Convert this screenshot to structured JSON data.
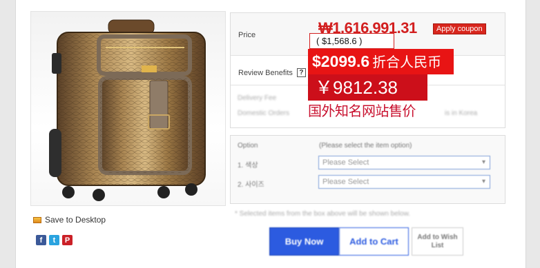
{
  "product": {
    "image_alt": "Brown snakeskin-texture rolling suitcase",
    "save_label": "Save to Desktop"
  },
  "social": {
    "facebook": "f",
    "twitter": "t",
    "pinterest": "P"
  },
  "price": {
    "label": "Price",
    "krw": "₩1,616,991.31",
    "coupon_label": "Apply coupon",
    "usd": "( $1,568.6 )"
  },
  "review": {
    "label": "Review Benefits",
    "help": "?"
  },
  "overlay": {
    "usd_price": "$2099.6",
    "usd_note": "折合人民币",
    "cny_price": "￥9812.38",
    "note": "国外知名网站售价"
  },
  "shipping": {
    "delivery_label": "Delivery Fee",
    "domestic_label": "Domestic Orders",
    "domestic_value": "is in Korea"
  },
  "options": {
    "label": "Option",
    "hint": "(Please select the item option)",
    "option1_label": "1. 색상",
    "option2_label": "2. 사이즈",
    "select_placeholder": "Please Select"
  },
  "note": "* Selected items from the box above will be shown below.",
  "buttons": {
    "buy": "Buy Now",
    "cart": "Add to Cart",
    "wish": "Add to Wish List"
  },
  "colors": {
    "accent": "#2c5be0",
    "price_red": "#d21f1f",
    "overlay_red": "#e81414"
  }
}
